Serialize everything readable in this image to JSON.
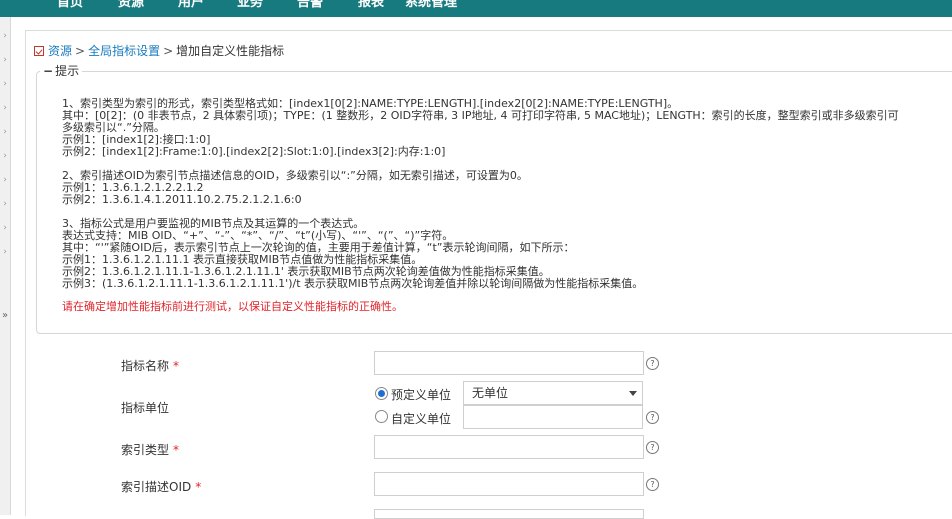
{
  "nav": {
    "items": [
      "首页",
      "资源",
      "用户",
      "业务",
      "告警",
      "报表",
      "系统管理"
    ]
  },
  "breadcrumb": {
    "items": [
      "资源",
      "全局指标设置",
      "增加自定义性能指标"
    ],
    "separator": ">"
  },
  "hint": {
    "legend_toggle": "−",
    "legend": "提示",
    "lines": [
      "1、索引类型为索引的形式，索引类型格式如：[index1[0[2]:NAME:TYPE:LENGTH].[index2[0[2]:NAME:TYPE:LENGTH]。",
      "其中：[0[2]：(0 非表节点，2 具体索引项)；TYPE：(1 整数形，2 OID字符串, 3 IP地址, 4 可打印字符串, 5 MAC地址)；LENGTH：索引的长度，整型索引或非多级索引可",
      "多级索引以“.”分隔。",
      "示例1：[index1[2]:接口:1:0]",
      "示例2：[index1[2]:Frame:1:0].[index2[2]:Slot:1:0].[index3[2]:内存:1:0]",
      "",
      "2、索引描述OID为索引节点描述信息的OID，多级索引以“:”分隔，如无索引描述，可设置为0。",
      "示例1：1.3.6.1.2.1.2.2.1.2",
      "示例2：1.3.6.1.4.1.2011.10.2.75.2.1.2.1.6:0",
      "",
      "3、指标公式是用户要监视的MIB节点及其运算的一个表达式。",
      "表达式支持：MIB OID、“+”、“-”、“*”、“/”、“t”(小写)、“'”、“(”、“)”字符。",
      "其中：“'”紧随OID后，表示索引节点上一次轮询的值，主要用于差值计算，“t”表示轮询间隔，如下所示：",
      "示例1：1.3.6.1.2.1.11.1 表示直接获取MIB节点值做为性能指标采集值。",
      "示例2：1.3.6.1.2.1.11.1-1.3.6.1.2.1.11.1' 表示获取MIB节点两次轮询差值做为性能指标采集值。",
      "示例3：(1.3.6.1.2.1.11.1-1.3.6.1.2.1.11.1')/t 表示获取MIB节点两次轮询差值并除以轮询间隔做为性能指标采集值。"
    ],
    "warning": "请在确定增加性能指标前进行测试，以保证自定义性能指标的正确性。"
  },
  "form": {
    "metric_name": {
      "label": "指标名称",
      "required": "*",
      "value": ""
    },
    "metric_unit": {
      "label": "指标单位",
      "predefined_label": "预定义单位",
      "predefined_selected": true,
      "predefined_value": "无单位",
      "custom_label": "自定义单位",
      "custom_value": ""
    },
    "index_type": {
      "label": "索引类型",
      "required": "*",
      "value": ""
    },
    "index_desc_oid": {
      "label": "索引描述OID",
      "required": "*",
      "value": ""
    },
    "help_glyph": "?"
  },
  "sidebar": {
    "collapse_glyph": "»",
    "arrow_glyph": "›"
  },
  "colors": {
    "nav_bg": "#177a7f",
    "link": "#1a7bbf",
    "warning": "#e0242b",
    "radio_checked": "#1f6fd1"
  }
}
